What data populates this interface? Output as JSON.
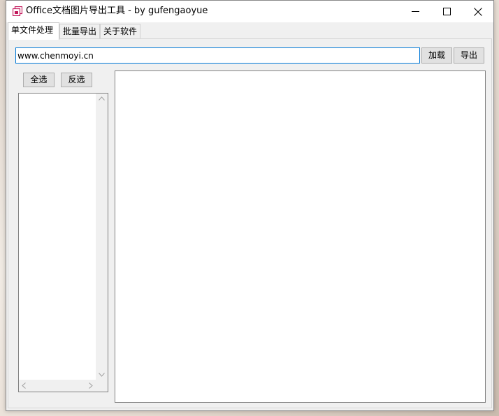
{
  "window": {
    "title": "Office文档图片导出工具 - by gufengaoyue",
    "icon": "app-icon",
    "controls": [
      "minimize-icon",
      "maximize-icon",
      "close-icon"
    ]
  },
  "tabs": [
    {
      "label": "单文件处理",
      "active": true
    },
    {
      "label": "批量导出",
      "active": false
    },
    {
      "label": "关于软件",
      "active": false
    }
  ],
  "single": {
    "path_value": "www.chenmoyi.cn",
    "load_label": "加载",
    "export_label": "导出",
    "select_all_label": "全选",
    "invert_label": "反选"
  },
  "colors": {
    "accent": "#0078d7",
    "window_bg": "#f0f0f0",
    "icon_pink": "#c2185b"
  }
}
